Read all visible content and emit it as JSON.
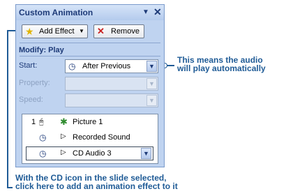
{
  "pane": {
    "title": "Custom Animation",
    "title_arrow": "▼",
    "close": "✕",
    "add_effect_label": "Add Effect",
    "add_effect_arrow": "▼",
    "remove_label": "Remove",
    "section_title": "Modify: Play",
    "start_label": "Start:",
    "start_value": "After Previous",
    "property_label": "Property:",
    "speed_label": "Speed:",
    "dropdown_arrow": "▼"
  },
  "effects_list": [
    {
      "number": "1",
      "name": "Picture 1"
    },
    {
      "number": "",
      "name": "Recorded Sound"
    },
    {
      "number": "",
      "name": "CD Audio 3"
    }
  ],
  "annotations": {
    "right_line1": "This means the audio",
    "right_line2": "will play automatically",
    "bottom_line1": "With the CD icon in the slide selected,",
    "bottom_line2": "click here to add an animation effect to it"
  },
  "colors": {
    "pane_bg": "#bfd3f0",
    "title_text": "#1d3a78",
    "annotation_text": "#1f5b96"
  }
}
